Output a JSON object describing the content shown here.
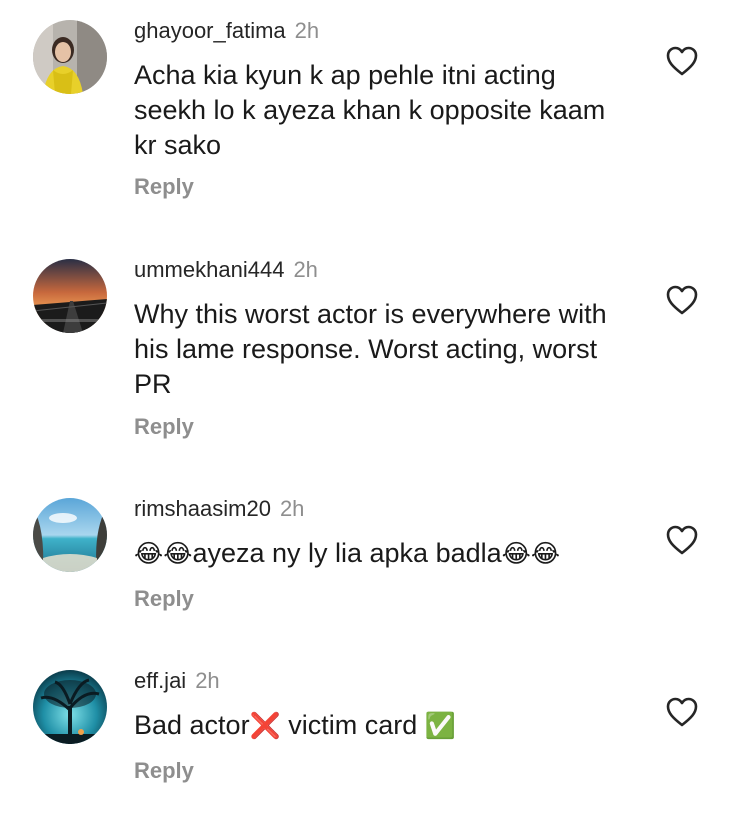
{
  "comments": [
    {
      "username": "ghayoor_fatima",
      "time": "2h",
      "text": "Acha kia kyun k ap pehle itni acting seekh lo k ayeza khan k opposite kaam kr sako",
      "reply_label": "Reply",
      "avatar_icon": "profile-photo",
      "like_icon": "heart-outline-icon"
    },
    {
      "username": "ummekhani444",
      "time": "2h",
      "text": "Why this worst actor is everywhere with his lame response. Worst acting, worst PR",
      "reply_label": "Reply",
      "avatar_icon": "profile-photo",
      "like_icon": "heart-outline-icon"
    },
    {
      "username": "rimshaasim20",
      "time": "2h",
      "text_parts": [
        "😂😂",
        "ayeza ny ly lia apka badla",
        "😂😂"
      ],
      "reply_label": "Reply",
      "avatar_icon": "profile-photo",
      "like_icon": "heart-outline-icon"
    },
    {
      "username": "eff.jai",
      "time": "2h",
      "text_parts": [
        "Bad actor",
        "❌",
        " victim card ",
        "✅"
      ],
      "reply_label": "Reply",
      "avatar_icon": "profile-photo",
      "like_icon": "heart-outline-icon"
    }
  ],
  "colors": {
    "username": "#262626",
    "secondary": "#8e8e8e",
    "text": "#1a1a1a",
    "heart_outline": "#262626"
  }
}
